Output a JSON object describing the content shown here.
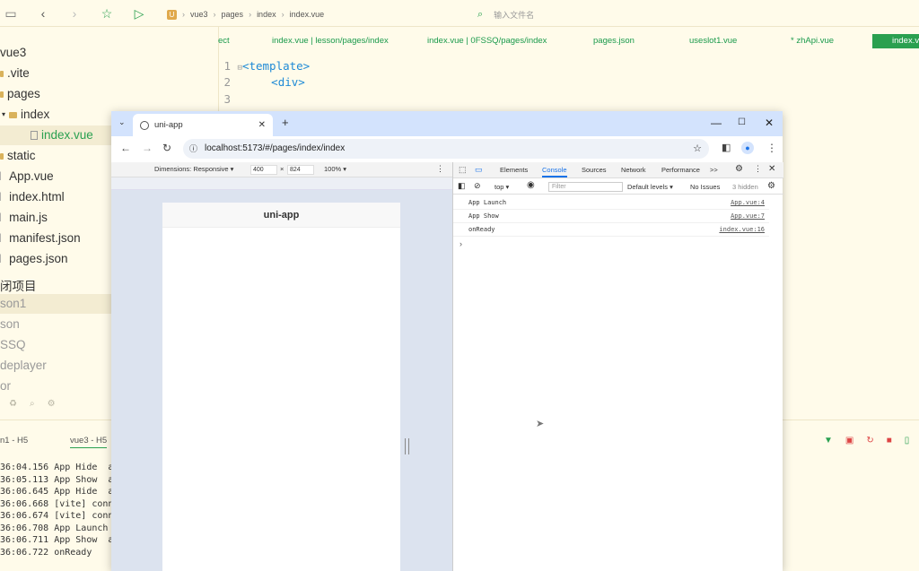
{
  "ide": {
    "breadcrumb": [
      "vue3",
      "pages",
      "index",
      "index.vue"
    ],
    "file_search_placeholder": "输入文件名",
    "tree": {
      "items": [
        {
          "label": "vue3"
        },
        {
          "label": ".vite"
        },
        {
          "label": "pages"
        },
        {
          "label": "index"
        },
        {
          "label": "index.vue"
        },
        {
          "label": "static"
        },
        {
          "label": "App.vue"
        },
        {
          "label": "index.html"
        },
        {
          "label": "main.js"
        },
        {
          "label": "manifest.json"
        },
        {
          "label": "pages.json"
        }
      ],
      "closed_projects_title": "闭项目",
      "closed_projects": [
        "son1",
        "son",
        "SSQ",
        "deplayer",
        "or"
      ]
    },
    "editor_tabs": [
      "ect",
      "index.vue | lesson/pages/index",
      "index.vue | 0FSSQ/pages/index",
      "pages.json",
      "useslot1.vue",
      "* zhApi.vue",
      "index.vu"
    ],
    "code_lines": [
      {
        "no": "1",
        "text": "<template>"
      },
      {
        "no": "2",
        "text": "    <div>"
      },
      {
        "no": "3",
        "text": ""
      }
    ],
    "terminal_tabs": [
      "n1 - H5",
      "vue3 - H5"
    ],
    "log_lines": [
      "36:04.156 App Hide  a",
      "36:05.113 App Show  a",
      "36:06.645 App Hide  a",
      "36:06.668 [vite] conn",
      "36:06.674 [vite] conn",
      "36:06.708 App Launch",
      "36:06.711 App Show  a",
      "36:06.722 onReady"
    ]
  },
  "browser": {
    "tab_title": "uni-app",
    "url": "localhost:5173/#/pages/index/index",
    "device_toolbar": {
      "dimensions_label": "Dimensions: Responsive ▾",
      "width": "400",
      "times": "×",
      "height": "824",
      "zoom": "100% ▾"
    },
    "page_title": "uni-app",
    "devtools": {
      "tabs": [
        "Elements",
        "Console",
        "Sources",
        "Network",
        "Performance",
        ">>"
      ],
      "active_tab": "Console",
      "context": "top ▾",
      "filter_placeholder": "Filter",
      "levels": "Default levels ▾",
      "issues": "No Issues",
      "hidden": "3 hidden",
      "console": [
        {
          "msg": "App Launch",
          "src": "App.vue:4"
        },
        {
          "msg": "App Show",
          "src": "App.vue:7"
        },
        {
          "msg": "onReady",
          "src": "index.vue:16"
        }
      ],
      "prompt": "›"
    }
  },
  "colors": {
    "accent_green": "#2aa050",
    "devtools_blue": "#1a73e8",
    "ide_bg": "#fffbea"
  }
}
